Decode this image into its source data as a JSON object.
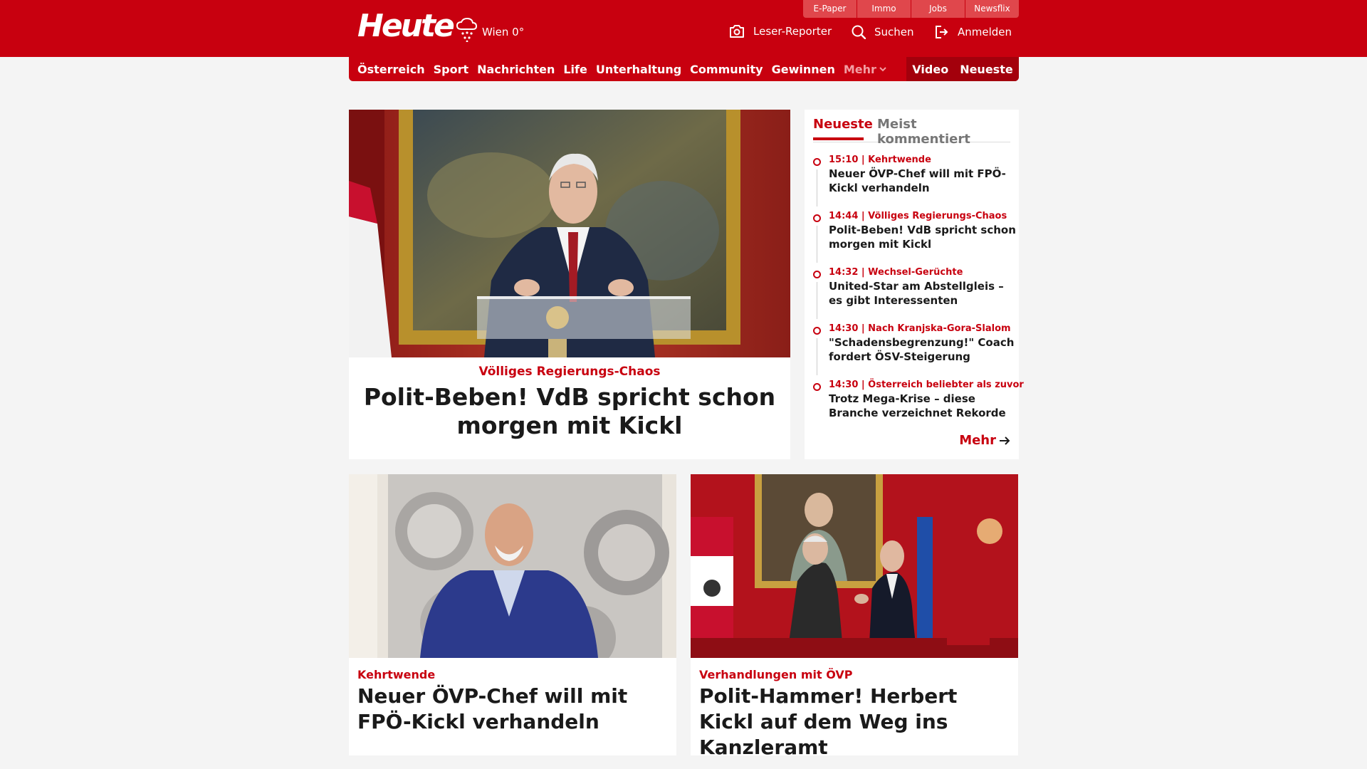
{
  "header": {
    "logo": "Heute",
    "weather": "Wien 0°",
    "meta_tabs": [
      "E-Paper",
      "Immo",
      "Jobs",
      "Newsflix"
    ],
    "leser_reporter": "Leser-Reporter",
    "suchen": "Suchen",
    "anmelden": "Anmelden"
  },
  "nav": {
    "items": [
      "Österreich",
      "Sport",
      "Nachrichten",
      "Life",
      "Unterhaltung",
      "Community",
      "Gewinnen"
    ],
    "more": "Mehr",
    "video": "Video",
    "neueste": "Neueste"
  },
  "hero": {
    "kicker": "Völliges Regierungs-Chaos",
    "title": "Polit-Beben! VdB spricht schon morgen mit Kickl"
  },
  "sidebar": {
    "tab_active": "Neueste",
    "tab_inactive": "Meist kommentiert",
    "items": [
      {
        "meta": "15:10 | Kehrtwende",
        "title": "Neuer ÖVP-Chef will mit FPÖ-Kickl verhandeln"
      },
      {
        "meta": "14:44 | Völliges Regierungs-Chaos",
        "title": "Polit-Beben! VdB spricht schon morgen mit Kickl"
      },
      {
        "meta": "14:32 | Wechsel-Gerüchte",
        "title": "United-Star am Abstellgleis – es gibt Interessenten"
      },
      {
        "meta": "14:30 | Nach Kranjska-Gora-Slalom",
        "title": "\"Schadensbegrenzung!\" Coach fordert ÖSV-Steigerung"
      },
      {
        "meta": "14:30 | Österreich beliebter als zuvor",
        "title": "Trotz Mega-Krise – diese Branche verzeichnet Rekorde"
      }
    ],
    "more": "Mehr"
  },
  "cards": [
    {
      "kicker": "Kehrtwende",
      "title": "Neuer ÖVP-Chef will mit FPÖ-Kickl verhandeln"
    },
    {
      "kicker": "Verhandlungen mit ÖVP",
      "title": "Polit-Hammer! Herbert Kickl auf dem Weg ins Kanzleramt"
    }
  ],
  "colors": {
    "brand_red": "#c8000f",
    "background": "#f4f4f4"
  },
  "icons": [
    "weather-snow-icon",
    "camera-icon",
    "search-icon",
    "login-icon",
    "chevron-down-icon",
    "arrow-right-icon"
  ]
}
